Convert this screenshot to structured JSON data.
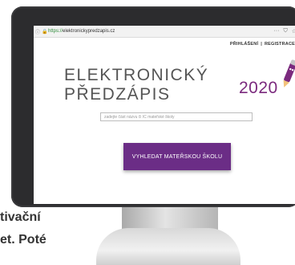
{
  "browser": {
    "url_proto": "https://",
    "url_host": "elektronickypredzapis.cz",
    "info_icon": "info-icon",
    "lock_icon": "lock-icon",
    "more_icon": "more-icon",
    "shield_icon": "shield-icon",
    "star_icon": "star-icon"
  },
  "header": {
    "login": "PŘIHLÁŠENÍ",
    "separator": "|",
    "register": "REGISTRACE"
  },
  "logo": {
    "text": "ELEKTRONICKÝ PŘEDZÁPIS",
    "year": "2020",
    "year_color": "#7b2a7e"
  },
  "search": {
    "placeholder": "zadejte část názvu či IČ mateřské školy"
  },
  "button": {
    "label": "VYHLEDAT MATEŘSKOU ŠKOLU",
    "color": "#6b2d86"
  },
  "page_text": {
    "line1": "tivační",
    "line2": "et. Poté"
  }
}
